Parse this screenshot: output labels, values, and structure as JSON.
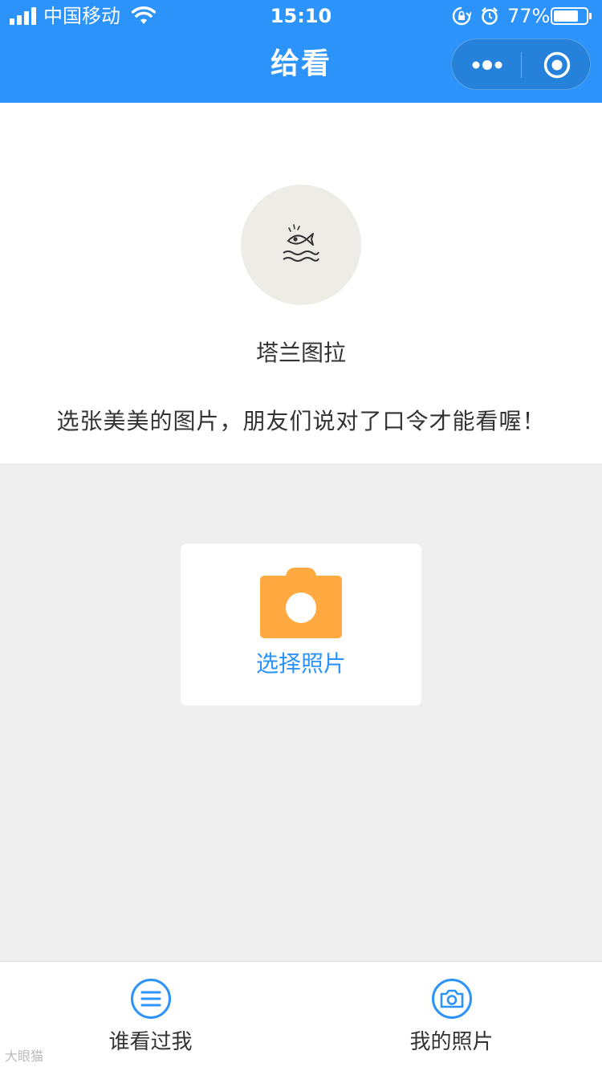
{
  "status_bar": {
    "carrier": "中国移动",
    "time": "15:10",
    "battery_percent": "77%",
    "battery_level": 0.77
  },
  "nav": {
    "title": "给看"
  },
  "profile": {
    "nickname": "塔兰图拉",
    "hint": "选张美美的图片，朋友们说对了口令才能看喔！"
  },
  "choose_photo": {
    "label": "选择照片",
    "icon_color": "#ffa940"
  },
  "tabbar": {
    "items": [
      {
        "label": "谁看过我",
        "icon": "list-circle-icon"
      },
      {
        "label": "我的照片",
        "icon": "camera-circle-icon"
      }
    ]
  },
  "watermark": "大眼猫",
  "colors": {
    "accent": "#2b93f9",
    "background": "#efefef"
  }
}
